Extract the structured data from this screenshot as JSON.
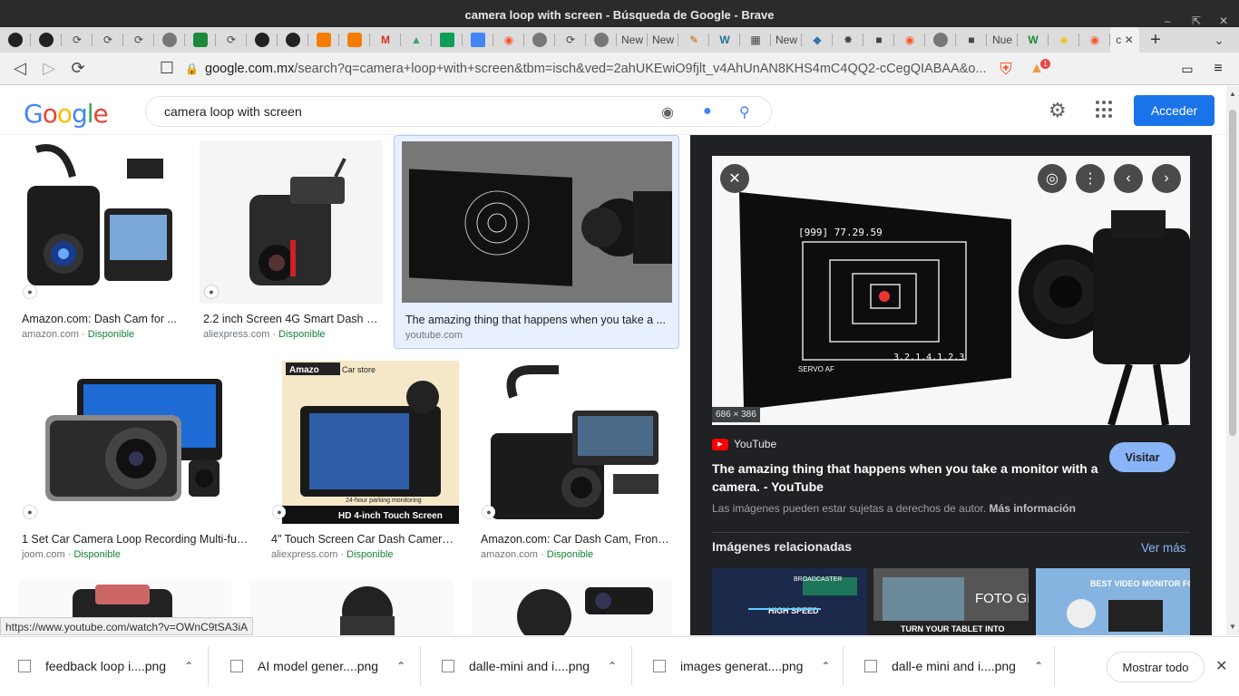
{
  "window": {
    "title": "camera loop with screen - Búsqueda de Google - Brave"
  },
  "tabs": [
    {
      "icon": "github-icon",
      "color": "#222"
    },
    {
      "icon": "github-icon",
      "color": "#222"
    },
    {
      "icon": "loop-icon",
      "color": "#555"
    },
    {
      "icon": "loop-icon",
      "color": "#555"
    },
    {
      "icon": "loop-icon",
      "color": "#555"
    },
    {
      "icon": "globe-icon",
      "color": "#666"
    },
    {
      "icon": "green-icon",
      "color": "#1a8a3a"
    },
    {
      "icon": "loop-icon",
      "color": "#555"
    },
    {
      "icon": "github-icon",
      "color": "#222"
    },
    {
      "icon": "github-icon",
      "color": "#222"
    },
    {
      "icon": "orange-icon",
      "color": "#f57c00"
    },
    {
      "icon": "orange-icon",
      "color": "#f57c00"
    },
    {
      "icon": "gmail-icon",
      "color": "#d93025"
    },
    {
      "icon": "drive-icon",
      "color": "#34a853"
    },
    {
      "icon": "plus-icon",
      "color": "#0f9d58"
    },
    {
      "icon": "docs-icon",
      "color": "#4285f4"
    },
    {
      "icon": "brave-icon",
      "color": "#fb542b"
    },
    {
      "icon": "globe-icon",
      "color": "#666"
    },
    {
      "icon": "loop-icon",
      "color": "#555"
    },
    {
      "icon": "globe-icon",
      "color": "#666"
    }
  ],
  "tab_labels": [
    "New",
    "New",
    "New",
    "Nue",
    "c"
  ],
  "toolbar": {
    "url_domain": "google.com.mx",
    "url_rest": "/search?q=camera+loop+with+screen&tbm=isch&ved=2ahUKEwiO9fjlt_v4AhUnAN8KHS4mC4QQ2-cCegQIABAA&o...",
    "brave_badge": "1"
  },
  "header": {
    "query": "camera loop with screen",
    "signin": "Acceder"
  },
  "results": [
    {
      "title": "Amazon.com: Dash Cam for ...",
      "source": "amazon.com",
      "avail": "Disponible"
    },
    {
      "title": "2.2 inch Screen 4G Smart Dash C...",
      "source": "aliexpress.com",
      "avail": "Disponible"
    },
    {
      "title": "The amazing thing that happens when you take a ...",
      "source": "youtube.com",
      "avail": ""
    },
    {
      "title": "1 Set Car Camera Loop Recording Multi-fun...",
      "source": "joom.com",
      "avail": "Disponible"
    },
    {
      "title": "4\" Touch Screen Car Dash Camera ...",
      "source": "aliexpress.com",
      "avail": "Disponible"
    },
    {
      "title": "Amazon.com: Car Dash Cam, Front ...",
      "source": "amazon.com",
      "avail": "Disponible"
    }
  ],
  "thumb_text": {
    "amazo": "Amazo",
    "car_store": "Car store",
    "parking": "24-hour parking monitoring",
    "hd": "HD 4-inch Touch Screen"
  },
  "panel": {
    "dims": "686 × 386",
    "source": "YouTube",
    "title": "The amazing thing that happens when you take a monitor with a camera. - YouTube",
    "visit": "Visitar",
    "copyright": "Las imágenes pueden estar sujetas a derechos de autor.",
    "more_info": "Más información",
    "related_heading": "Imágenes relacionadas",
    "see_more": "Ver más",
    "screen_text": "[999] 77.29.59",
    "screen_bottom": "3.2.1.4.1.2.3",
    "servo": "SERVO AF"
  },
  "related_text": [
    "HIGH SPEED",
    "BROADCASTER",
    "FOTO GRAPHY",
    "TURN YOUR TABLET INTO",
    "BEST VIDEO MONITOR FOR YOU!"
  ],
  "status_url": "https://www.youtube.com/watch?v=OWnC9tSA3iA",
  "downloads": [
    "feedback loop i....png",
    "AI model gener....png",
    "dalle-mini and i....png",
    "images generat....png",
    "dall-e mini and i....png"
  ],
  "show_all": "Mostrar todo"
}
